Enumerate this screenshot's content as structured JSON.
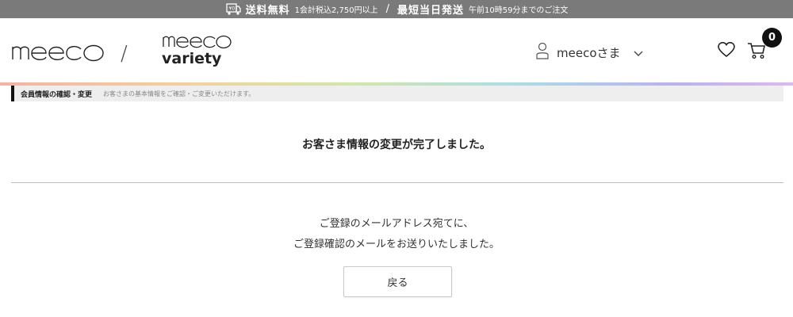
{
  "topbar": {
    "shipping_free": "送料無料",
    "shipping_condition": "1会計税込2,750円以上",
    "separator": "/",
    "same_day": "最短当日発送",
    "same_day_condition": "午前10時59分までのご注文",
    "icon": "delivery-truck-icon"
  },
  "header": {
    "logo_primary": "meeco",
    "logo_divider": "/",
    "logo_secondary_top": "meeco",
    "logo_secondary_bottom": "variety",
    "user_name": "meecoさま",
    "cart_count": "0"
  },
  "breadcrumb": {
    "title": "会員情報の確認・変更",
    "description": "お客さまの基本情報をご確認・ご変更いただけます。"
  },
  "main": {
    "complete_message": "お客さま情報の変更が完了しました。",
    "mail_line1": "ご登録のメールアドレス宛てに、",
    "mail_line2": "ご登録確認のメールをお送りいたしました。",
    "back_label": "戻る"
  },
  "colors": {
    "topbar_bg": "#7a7a7a",
    "crumb_bg": "#eeeeee",
    "badge_bg": "#111111"
  }
}
